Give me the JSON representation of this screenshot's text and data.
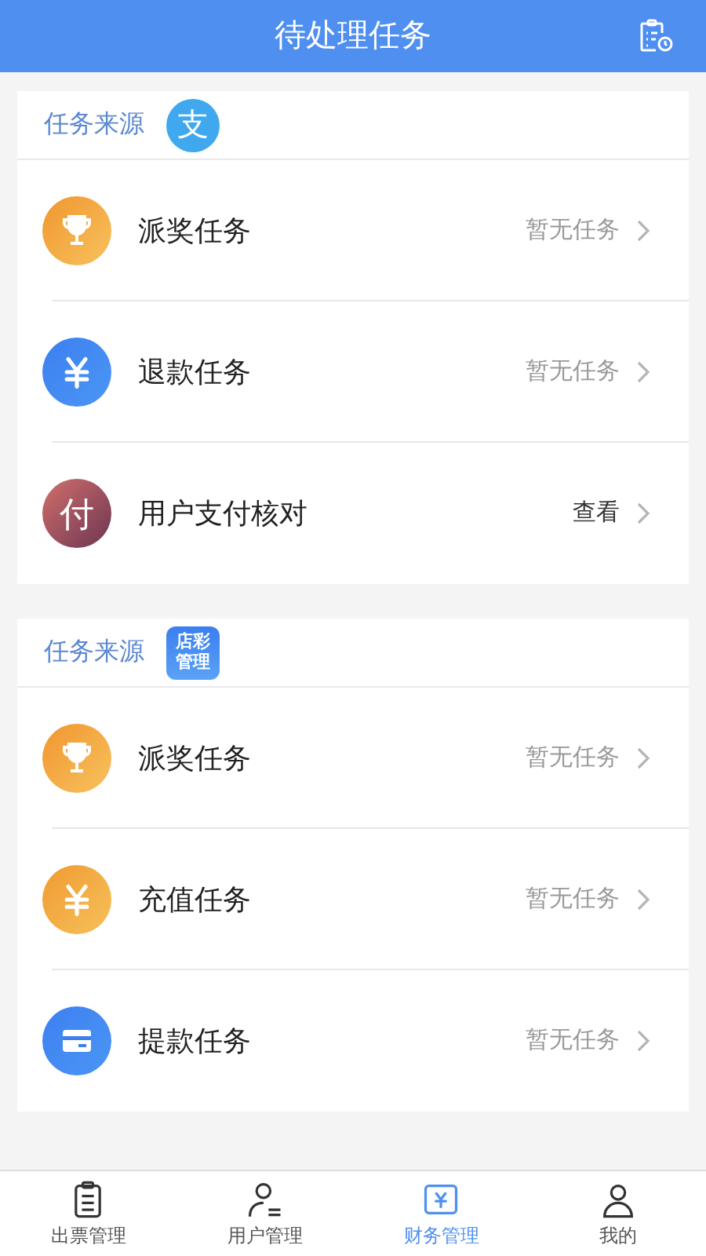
{
  "header": {
    "title": "待处理任务"
  },
  "sections": [
    {
      "source_label": "任务来源",
      "logo": {
        "kind": "round",
        "text": "支"
      },
      "rows": [
        {
          "kind": "trophy",
          "label": "派奖任务",
          "status": "暂无任务",
          "highlight": false
        },
        {
          "kind": "yen",
          "label": "退款任务",
          "status": "暂无任务",
          "highlight": false
        },
        {
          "kind": "char",
          "icon_text": "付",
          "label": "用户支付核对",
          "status": "查看",
          "highlight": true
        }
      ]
    },
    {
      "source_label": "任务来源",
      "logo": {
        "kind": "square",
        "text": "店彩",
        "text2": "管理"
      },
      "rows": [
        {
          "kind": "trophy",
          "label": "派奖任务",
          "status": "暂无任务",
          "highlight": false
        },
        {
          "kind": "recharge",
          "label": "充值任务",
          "status": "暂无任务",
          "highlight": false
        },
        {
          "kind": "card",
          "label": "提款任务",
          "status": "暂无任务",
          "highlight": false
        }
      ]
    }
  ],
  "tab_bar": [
    {
      "kind": "tickets",
      "label": "出票管理",
      "selected": false
    },
    {
      "kind": "users",
      "label": "用户管理",
      "selected": false
    },
    {
      "kind": "finance",
      "label": "财务管理",
      "selected": true
    },
    {
      "kind": "me",
      "label": "我的",
      "selected": false
    }
  ]
}
